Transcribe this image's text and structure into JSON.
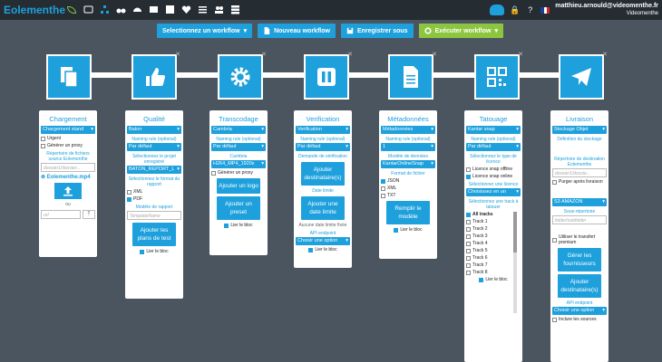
{
  "topbar": {
    "logo_text": "Eolementhe",
    "nav_icons": [
      "cc-icon",
      "sitemap-icon",
      "binoculars-icon",
      "dashboard-icon",
      "table-icon",
      "chart-icon",
      "heartbeat-icon",
      "list-icon",
      "users-icon",
      "stack-icon"
    ],
    "cloud_label": "",
    "user_email": "matthieu.arnould@videomenthe.fr",
    "user_org": "Videomenthe",
    "language": "FR"
  },
  "actions": {
    "select_workflow": "Selectionnez un workflow",
    "new_workflow": "Nouveau workflow",
    "save_as": "Enregistrer sous",
    "run_workflow": "Exécuter workflow"
  },
  "colors": {
    "accent": "#1ea0dc",
    "green": "#8cc63f",
    "background": "#4a5560"
  },
  "cards": {
    "chargement": {
      "title": "Chargement",
      "select": "Chargement stand",
      "urgent": "Urgent",
      "gen_proxy": "Générer un proxy",
      "repertoire": "Répertoire de fichiers source Eolementhe",
      "dir_placeholder": "dossier1/dossier...",
      "file": "Eolementhe.mp4",
      "ou": "ou",
      "url_placeholder": "url"
    },
    "qualite": {
      "title": "Qualité",
      "select": "Baton",
      "naming_label": "Naming rule (optional)",
      "naming_value": "Par défaut",
      "projet_label": "Sélectionnez le projet enregistré",
      "projet_value": "BATON_REPORT_L",
      "format_label": "Sélectionnez le format du rapport",
      "xml": "XML",
      "pdf": "PDF",
      "modele_label": "Modèle de rapport",
      "modele_placeholder": "TemplateName",
      "button": "Ajouter les plans de test",
      "lier": "Lier le bloc"
    },
    "transcodage": {
      "title": "Transcodage",
      "select": "Cambria",
      "naming_label": "Naming rule (optional)",
      "naming_value": "Par défaut",
      "cambria_label": "Cambria",
      "cambria_value": "H264_MP4_1920x",
      "gen_proxy": "Générer un proxy",
      "add_logo": "Ajouter un logo",
      "add_preset": "Ajouter un preset",
      "lier": "Lier le bloc"
    },
    "verification": {
      "title": "Verification",
      "select": "Verification",
      "naming_label": "Naming rule (optional)",
      "naming_value": "Par défaut",
      "demande_label": "Demande de vérification",
      "add_dest": "Ajouter destinataire(s)",
      "date_label": "Date limite",
      "add_date": "Ajouter une date limite",
      "aucune": "Aucune date limite fixée",
      "api_label": "API endpoint",
      "api_value": "Choisir une option",
      "lier": "Lier le bloc"
    },
    "metadonnees": {
      "title": "Métadonnées",
      "select": "Métadonnées",
      "naming_label": "Naming rule (optional)",
      "naming_value": "1",
      "modele_label": "Modèle de données",
      "modele_value": "KantarOnlineSnap",
      "format_label": "Format de fichier",
      "json": "JSON",
      "xml": "XML",
      "txt": "TXT",
      "button": "Remplir le modèle",
      "lier": "Lier le bloc"
    },
    "tatouage": {
      "title": "Tatouage",
      "select": "Kantar snap",
      "naming_label": "Naming rule (optional)",
      "naming_value": "Par défaut",
      "type_label": "Sélectionnez le type de licence",
      "offline": "Licence snap offline",
      "online": "Licence snap online",
      "licence_label": "Sélectionner une licence",
      "licence_value": "Choisissez en un",
      "track_label": "Sélectionnez une track à tatouer",
      "tracks": [
        "All tracks",
        "Track 1",
        "Track 2",
        "Track 3",
        "Track 4",
        "Track 5",
        "Track 6",
        "Track 7",
        "Track 8"
      ],
      "lier": "Lier le bloc"
    },
    "livraison": {
      "title": "Livraison",
      "select": "Stockage Objet",
      "def_label": "Définition du stockage",
      "rep_label": "Répertoire de destination Eolementhe",
      "rep_placeholder": "dossier1/dossie...",
      "purger": "Purger après livraison",
      "s3": "S3 AMAZON",
      "sous_label": "Sous-répertoire",
      "sous_placeholder": "folder/subfolder",
      "transfert": "Utiliser le transfert premium",
      "fournisseurs": "Gérer les fournisseurs",
      "add_dest": "Ajouter destinataire(s)",
      "api_label": "API endpoint",
      "api_value": "Choisir une option",
      "inclure": "Inclure les sources"
    }
  }
}
